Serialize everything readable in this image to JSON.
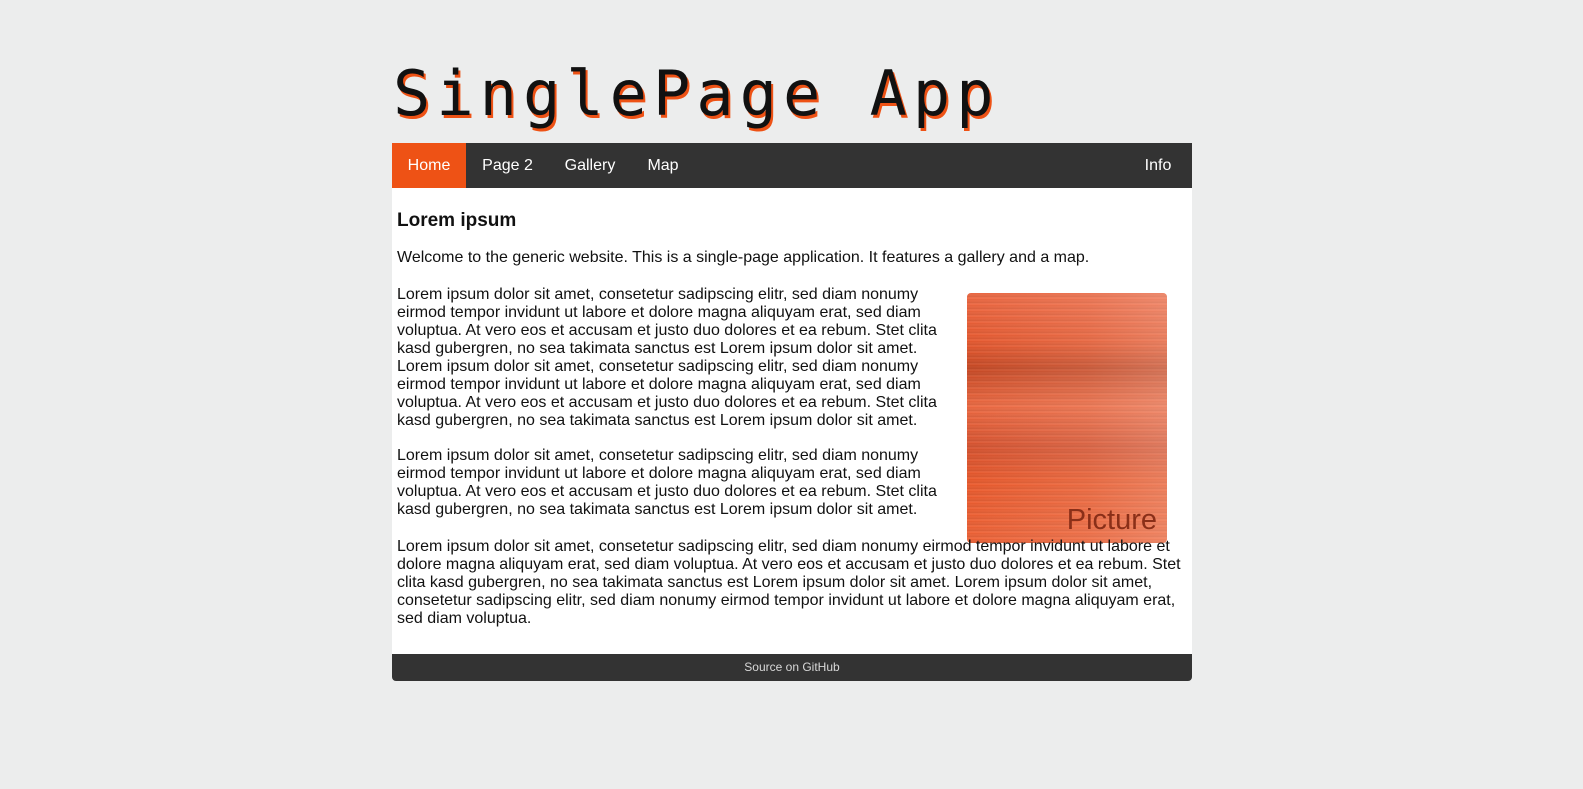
{
  "logo": {
    "text": "SinglePage App"
  },
  "nav": {
    "items": [
      {
        "label": "Home",
        "active": true
      },
      {
        "label": "Page 2",
        "active": false
      },
      {
        "label": "Gallery",
        "active": false
      },
      {
        "label": "Map",
        "active": false
      }
    ],
    "right_item": {
      "label": "Info"
    }
  },
  "content": {
    "heading": "Lorem ipsum",
    "welcome": "Welcome to the generic website. This is a single-page application. It features a gallery and a map.",
    "paragraph1": "Lorem ipsum dolor sit amet, consetetur sadipscing elitr, sed diam nonumy eirmod tempor invidunt ut labore et dolore magna aliquyam erat, sed diam voluptua. At vero eos et accusam et justo duo dolores et ea rebum. Stet clita kasd gubergren, no sea takimata sanctus est Lorem ipsum dolor sit amet. Lorem ipsum dolor sit amet, consetetur sadipscing elitr, sed diam nonumy eirmod tempor invidunt ut labore et dolore magna aliquyam erat, sed diam voluptua. At vero eos et accusam et justo duo dolores et ea rebum. Stet clita kasd gubergren, no sea takimata sanctus est Lorem ipsum dolor sit amet.",
    "paragraph2": "Lorem ipsum dolor sit amet, consetetur sadipscing elitr, sed diam nonumy eirmod tempor invidunt ut labore et dolore magna aliquyam erat, sed diam voluptua. At vero eos et accusam et justo duo dolores et ea rebum. Stet clita kasd gubergren, no sea takimata sanctus est Lorem ipsum dolor sit amet.",
    "paragraph3": "Lorem ipsum dolor sit amet, consetetur sadipscing elitr, sed diam nonumy eirmod tempor invidunt ut labore et dolore magna aliquyam erat, sed diam voluptua. At vero eos et accusam et justo duo dolores et ea rebum. Stet clita kasd gubergren, no sea takimata sanctus est Lorem ipsum dolor sit amet. Lorem ipsum dolor sit amet, consetetur sadipscing elitr, sed diam nonumy eirmod tempor invidunt ut labore et dolore magna aliquyam erat, sed diam voluptua.",
    "picture_label": "Picture"
  },
  "footer": {
    "link_text": "Source on GitHub"
  },
  "colors": {
    "background": "#eceded",
    "accent": "#ee5215",
    "navbar": "#333333",
    "content_bg": "#ffffff"
  }
}
